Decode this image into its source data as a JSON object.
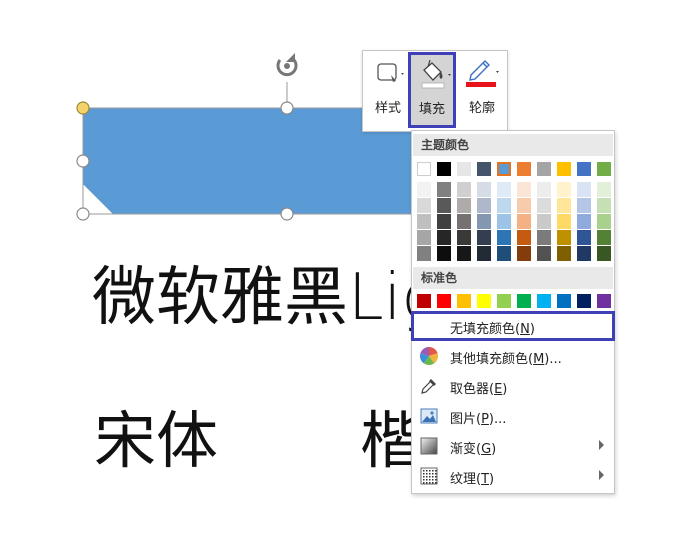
{
  "slide": {
    "line1": "微软雅黑Lig",
    "line2": "宋体",
    "line3": "楷"
  },
  "toolbar": {
    "style_label": "样式",
    "fill_label": "填充",
    "outline_label": "轮廓",
    "outline_color": "#e8141c"
  },
  "colors": {
    "shape_fill": "#5b9bd5",
    "highlight": "#3f3fb8"
  },
  "fill_menu": {
    "theme_colors_header": "主题颜色",
    "theme_colors": [
      "#ffffff",
      "#000000",
      "#e7e6e6",
      "#44546a",
      "#5b9bd5",
      "#ed7d31",
      "#a5a5a5",
      "#ffc000",
      "#4472c4",
      "#70ad47"
    ],
    "theme_tints": [
      [
        "#f2f2f2",
        "#d9d9d9",
        "#bfbfbf",
        "#a6a6a6",
        "#808080"
      ],
      [
        "#808080",
        "#595959",
        "#404040",
        "#262626",
        "#0d0d0d"
      ],
      [
        "#d0cece",
        "#afabab",
        "#767171",
        "#3b3838",
        "#181717"
      ],
      [
        "#d6dce5",
        "#adb9ca",
        "#8497b0",
        "#333f50",
        "#222a35"
      ],
      [
        "#deebf7",
        "#bdd7ee",
        "#9dc3e6",
        "#2e75b6",
        "#1f4e79"
      ],
      [
        "#fbe5d6",
        "#f8cbad",
        "#f4b183",
        "#c55a11",
        "#843c0c"
      ],
      [
        "#ededed",
        "#dbdbdb",
        "#c9c9c9",
        "#7b7b7b",
        "#525252"
      ],
      [
        "#fff2cc",
        "#ffe699",
        "#ffd966",
        "#bf9000",
        "#7f6000"
      ],
      [
        "#dae3f3",
        "#b4c7e7",
        "#8faadc",
        "#2f5597",
        "#203864"
      ],
      [
        "#e2f0d9",
        "#c5e0b4",
        "#a9d18e",
        "#548235",
        "#385723"
      ]
    ],
    "standard_colors_header": "标准色",
    "standard_colors": [
      "#c00000",
      "#ff0000",
      "#ffc000",
      "#ffff00",
      "#92d050",
      "#00b050",
      "#00b0f0",
      "#0070c0",
      "#002060",
      "#7030a0"
    ],
    "items": {
      "no_fill": "无填充颜色(",
      "no_fill_key": "N",
      "no_fill_end": ")",
      "more_colors": "其他填充颜色(",
      "more_colors_key": "M",
      "more_colors_end": ")...",
      "eyedropper": "取色器(",
      "eyedropper_key": "E",
      "eyedropper_end": ")",
      "picture": "图片(",
      "picture_key": "P",
      "picture_end": ")...",
      "gradient": "渐变(",
      "gradient_key": "G",
      "gradient_end": ")",
      "texture": "纹理(",
      "texture_key": "T",
      "texture_end": ")"
    }
  }
}
